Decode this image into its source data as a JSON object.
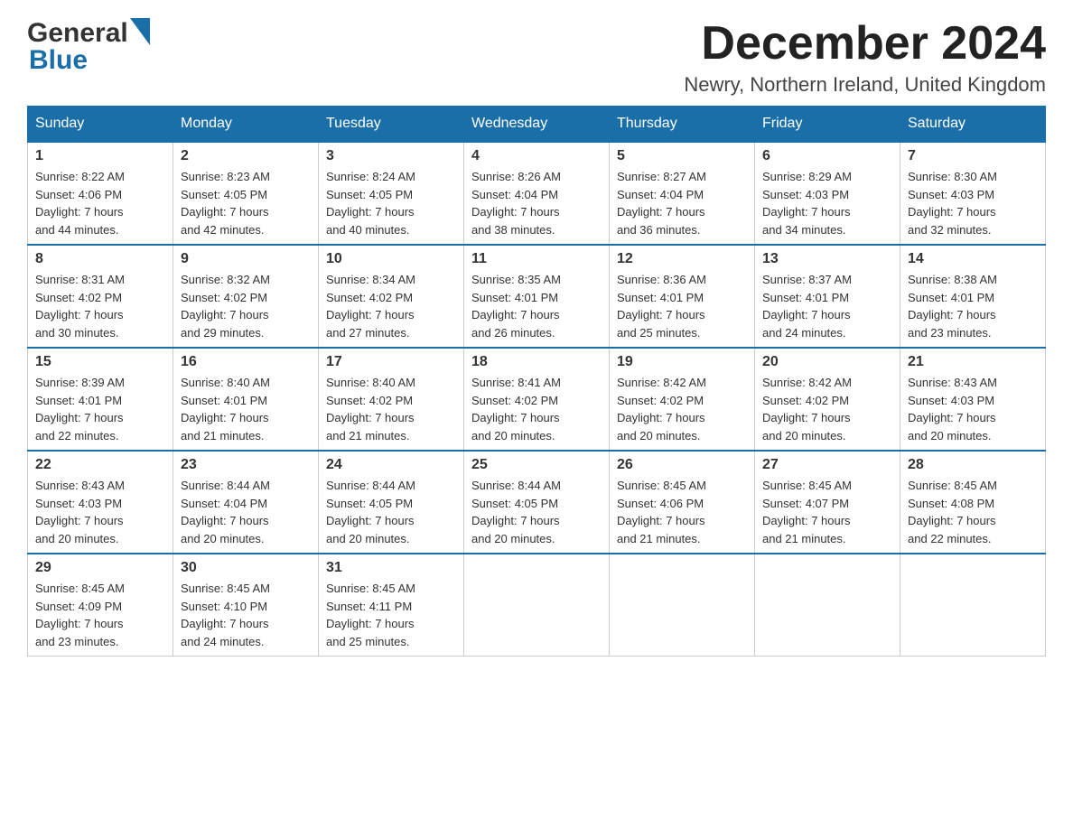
{
  "logo": {
    "general": "General",
    "blue": "Blue"
  },
  "title": "December 2024",
  "location": "Newry, Northern Ireland, United Kingdom",
  "weekdays": [
    "Sunday",
    "Monday",
    "Tuesday",
    "Wednesday",
    "Thursday",
    "Friday",
    "Saturday"
  ],
  "weeks": [
    [
      {
        "day": "1",
        "sunrise": "8:22 AM",
        "sunset": "4:06 PM",
        "daylight": "7 hours and 44 minutes."
      },
      {
        "day": "2",
        "sunrise": "8:23 AM",
        "sunset": "4:05 PM",
        "daylight": "7 hours and 42 minutes."
      },
      {
        "day": "3",
        "sunrise": "8:24 AM",
        "sunset": "4:05 PM",
        "daylight": "7 hours and 40 minutes."
      },
      {
        "day": "4",
        "sunrise": "8:26 AM",
        "sunset": "4:04 PM",
        "daylight": "7 hours and 38 minutes."
      },
      {
        "day": "5",
        "sunrise": "8:27 AM",
        "sunset": "4:04 PM",
        "daylight": "7 hours and 36 minutes."
      },
      {
        "day": "6",
        "sunrise": "8:29 AM",
        "sunset": "4:03 PM",
        "daylight": "7 hours and 34 minutes."
      },
      {
        "day": "7",
        "sunrise": "8:30 AM",
        "sunset": "4:03 PM",
        "daylight": "7 hours and 32 minutes."
      }
    ],
    [
      {
        "day": "8",
        "sunrise": "8:31 AM",
        "sunset": "4:02 PM",
        "daylight": "7 hours and 30 minutes."
      },
      {
        "day": "9",
        "sunrise": "8:32 AM",
        "sunset": "4:02 PM",
        "daylight": "7 hours and 29 minutes."
      },
      {
        "day": "10",
        "sunrise": "8:34 AM",
        "sunset": "4:02 PM",
        "daylight": "7 hours and 27 minutes."
      },
      {
        "day": "11",
        "sunrise": "8:35 AM",
        "sunset": "4:01 PM",
        "daylight": "7 hours and 26 minutes."
      },
      {
        "day": "12",
        "sunrise": "8:36 AM",
        "sunset": "4:01 PM",
        "daylight": "7 hours and 25 minutes."
      },
      {
        "day": "13",
        "sunrise": "8:37 AM",
        "sunset": "4:01 PM",
        "daylight": "7 hours and 24 minutes."
      },
      {
        "day": "14",
        "sunrise": "8:38 AM",
        "sunset": "4:01 PM",
        "daylight": "7 hours and 23 minutes."
      }
    ],
    [
      {
        "day": "15",
        "sunrise": "8:39 AM",
        "sunset": "4:01 PM",
        "daylight": "7 hours and 22 minutes."
      },
      {
        "day": "16",
        "sunrise": "8:40 AM",
        "sunset": "4:01 PM",
        "daylight": "7 hours and 21 minutes."
      },
      {
        "day": "17",
        "sunrise": "8:40 AM",
        "sunset": "4:02 PM",
        "daylight": "7 hours and 21 minutes."
      },
      {
        "day": "18",
        "sunrise": "8:41 AM",
        "sunset": "4:02 PM",
        "daylight": "7 hours and 20 minutes."
      },
      {
        "day": "19",
        "sunrise": "8:42 AM",
        "sunset": "4:02 PM",
        "daylight": "7 hours and 20 minutes."
      },
      {
        "day": "20",
        "sunrise": "8:42 AM",
        "sunset": "4:02 PM",
        "daylight": "7 hours and 20 minutes."
      },
      {
        "day": "21",
        "sunrise": "8:43 AM",
        "sunset": "4:03 PM",
        "daylight": "7 hours and 20 minutes."
      }
    ],
    [
      {
        "day": "22",
        "sunrise": "8:43 AM",
        "sunset": "4:03 PM",
        "daylight": "7 hours and 20 minutes."
      },
      {
        "day": "23",
        "sunrise": "8:44 AM",
        "sunset": "4:04 PM",
        "daylight": "7 hours and 20 minutes."
      },
      {
        "day": "24",
        "sunrise": "8:44 AM",
        "sunset": "4:05 PM",
        "daylight": "7 hours and 20 minutes."
      },
      {
        "day": "25",
        "sunrise": "8:44 AM",
        "sunset": "4:05 PM",
        "daylight": "7 hours and 20 minutes."
      },
      {
        "day": "26",
        "sunrise": "8:45 AM",
        "sunset": "4:06 PM",
        "daylight": "7 hours and 21 minutes."
      },
      {
        "day": "27",
        "sunrise": "8:45 AM",
        "sunset": "4:07 PM",
        "daylight": "7 hours and 21 minutes."
      },
      {
        "day": "28",
        "sunrise": "8:45 AM",
        "sunset": "4:08 PM",
        "daylight": "7 hours and 22 minutes."
      }
    ],
    [
      {
        "day": "29",
        "sunrise": "8:45 AM",
        "sunset": "4:09 PM",
        "daylight": "7 hours and 23 minutes."
      },
      {
        "day": "30",
        "sunrise": "8:45 AM",
        "sunset": "4:10 PM",
        "daylight": "7 hours and 24 minutes."
      },
      {
        "day": "31",
        "sunrise": "8:45 AM",
        "sunset": "4:11 PM",
        "daylight": "7 hours and 25 minutes."
      },
      null,
      null,
      null,
      null
    ]
  ],
  "labels": {
    "sunrise": "Sunrise:",
    "sunset": "Sunset:",
    "daylight": "Daylight:"
  },
  "colors": {
    "header_bg": "#1a6fa8",
    "border": "#1a6fa8"
  }
}
